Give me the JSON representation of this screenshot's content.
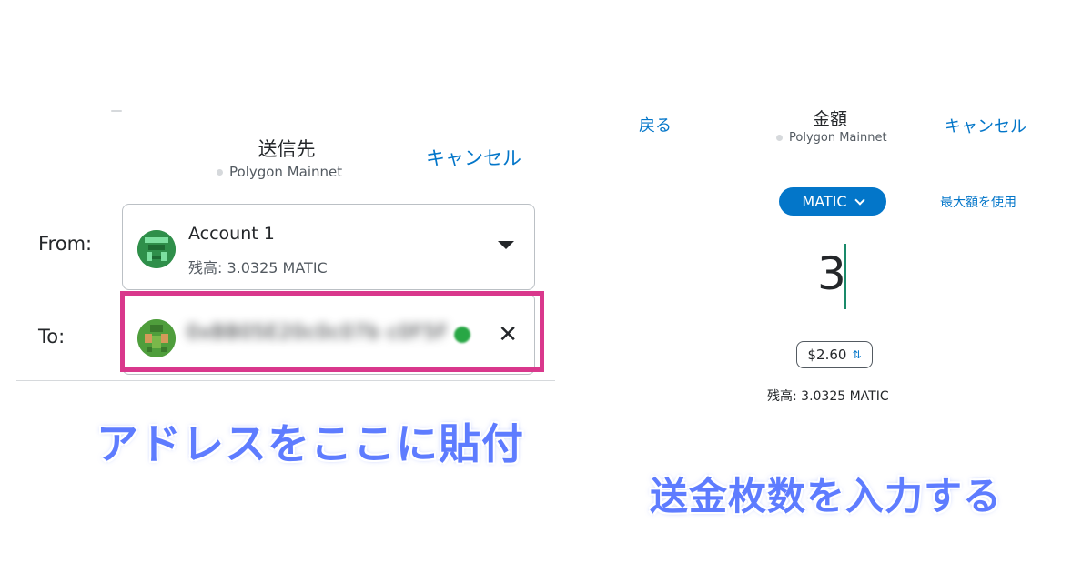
{
  "left": {
    "title": "送信先",
    "network": "Polygon Mainnet",
    "cancel": "キャンセル",
    "from_label": "From:",
    "to_label": "To:",
    "account_name": "Account 1",
    "account_balance": "残高: 3.0325 MATIC",
    "recipient_address": "0xBB05E20c0c07b  c0F5F",
    "clear_icon": "✕",
    "caption": "アドレスをここに貼付"
  },
  "right": {
    "back": "戻る",
    "title": "金額",
    "network": "Polygon Mainnet",
    "cancel": "キャンセル",
    "token": "MATIC",
    "max_link": "最大額を使用",
    "amount": "3",
    "fiat_value": "$2.60",
    "swap_icon": "⇅",
    "balance": "残高: 3.0325 MATIC",
    "caption": "送金枚数を入力する"
  },
  "colors": {
    "link": "#0376c9",
    "highlight": "#d9388c",
    "caption": "#5e7cff",
    "token_button": "#0376c9"
  },
  "icons": [
    "network-dot-icon",
    "caret-down-icon",
    "close-icon",
    "chevron-down-icon",
    "swap-icon",
    "identicon-avatar"
  ]
}
